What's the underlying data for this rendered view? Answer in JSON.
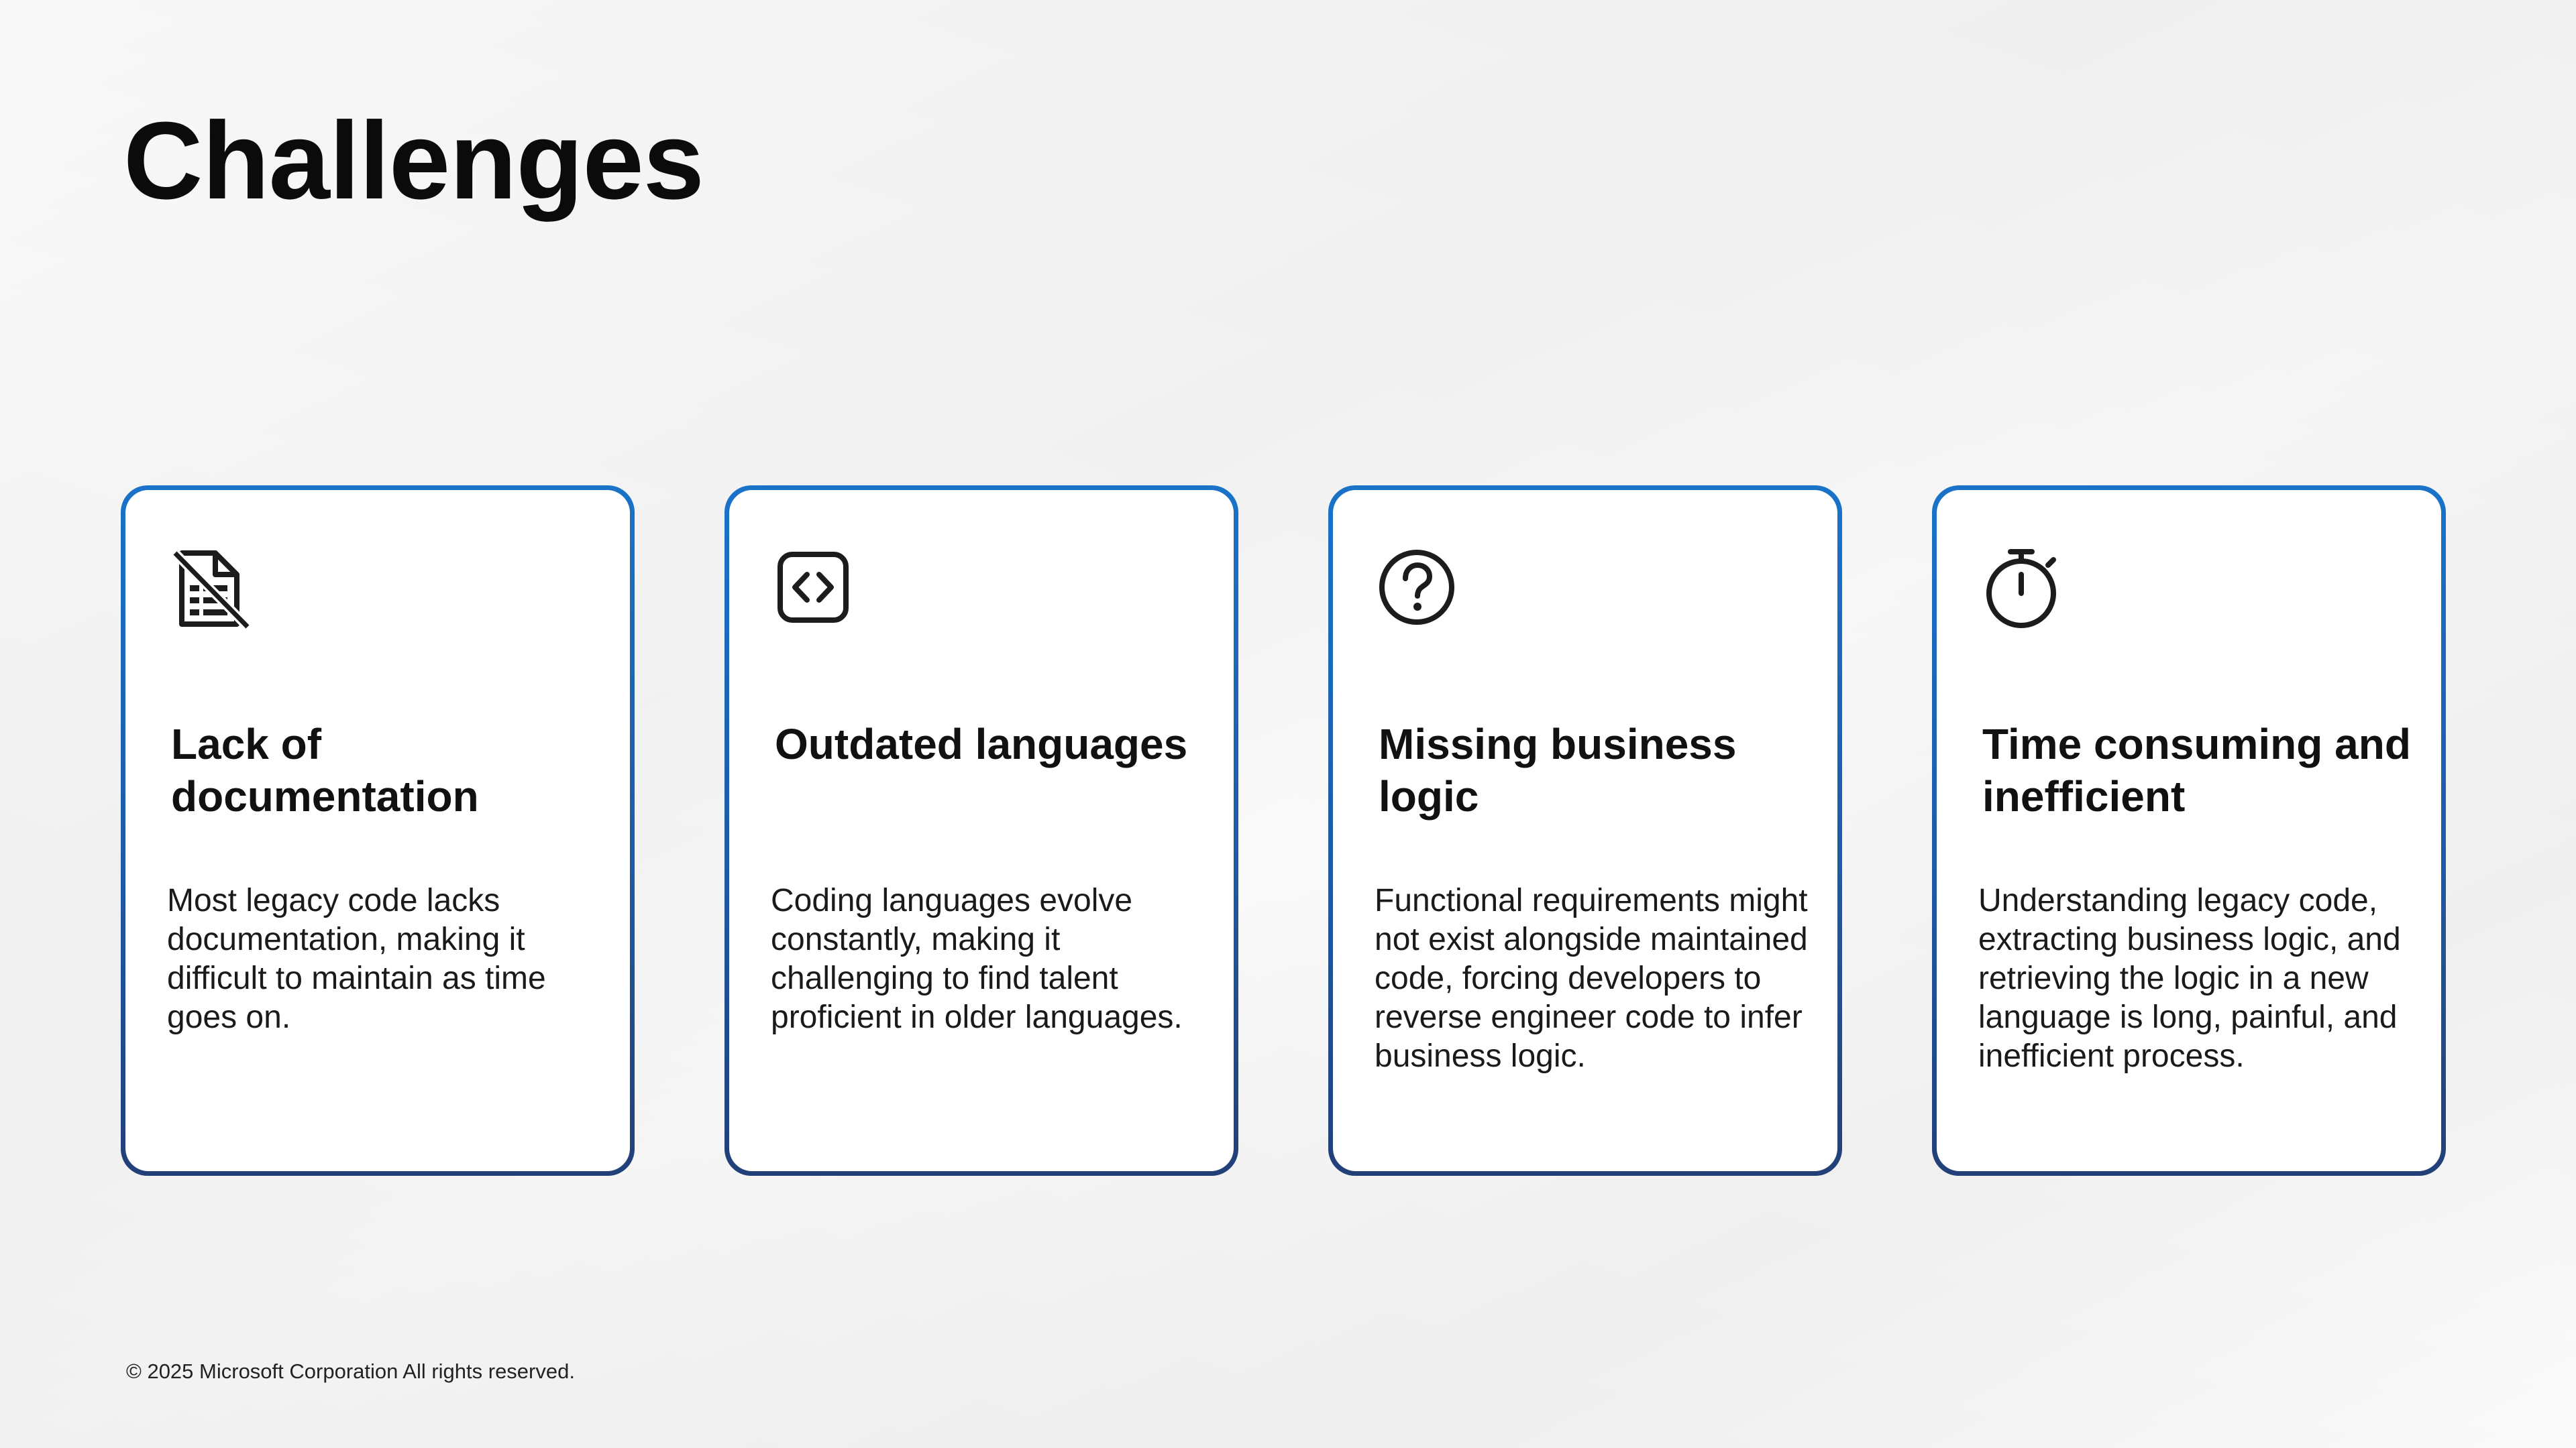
{
  "slide": {
    "title": "Challenges",
    "footer": "© 2025 Microsoft Corporation All rights reserved."
  },
  "cards": [
    {
      "icon": "document-crossed-icon",
      "title": "Lack of documentation",
      "body": "Most legacy code lacks documentation, making it difficult to maintain as time goes on."
    },
    {
      "icon": "code-brackets-icon",
      "title": "Outdated languages",
      "body": "Coding languages evolve constantly, making it challenging to find talent proficient in older languages."
    },
    {
      "icon": "question-circle-icon",
      "title": "Missing business logic",
      "body": "Functional requirements might not exist alongside maintained code, forcing developers to reverse engineer code to infer business logic."
    },
    {
      "icon": "stopwatch-icon",
      "title": "Time consuming and inefficient",
      "body": "Understanding legacy code, extracting business logic, and retrieving the logic in a new language is long, painful, and inefficient process."
    }
  ],
  "colors": {
    "card_border_top": "#1a73c9",
    "card_border_bottom": "#223f78",
    "icon": "#1c1c1c"
  }
}
